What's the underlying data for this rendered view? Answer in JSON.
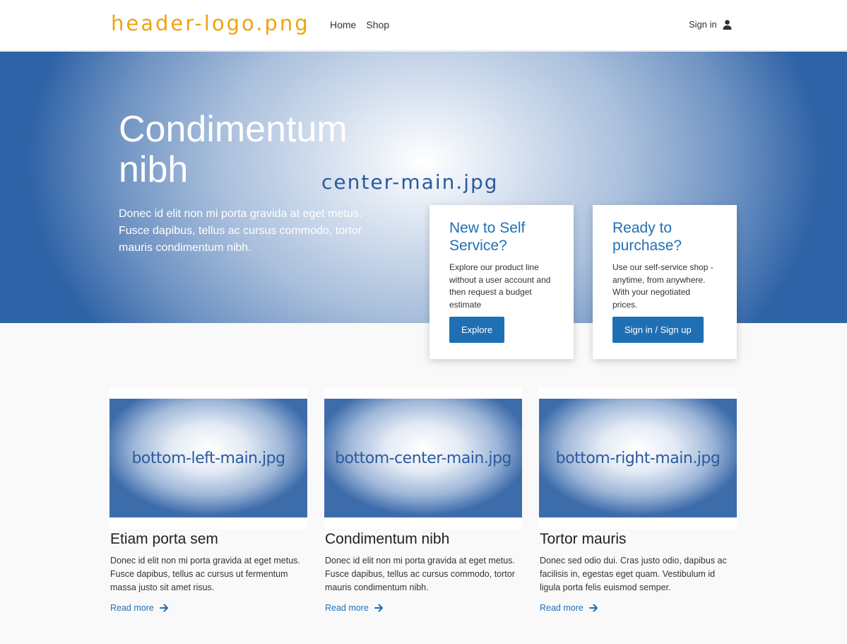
{
  "header": {
    "logo": "header-logo.png",
    "nav": [
      "Home",
      "Shop"
    ],
    "signin_label": "Sign in",
    "user_icon": "user-icon"
  },
  "hero": {
    "title": "Condimentum nibh",
    "subtitle": "Donec id elit non mi porta gravida at eget metus. Fusce dapibus, tellus ac cursus commodo, tortor mauris condimentum nibh.",
    "image_label": "center-main.jpg"
  },
  "cards": [
    {
      "title": "New to Self Service?",
      "text": "Explore our product line without a user account and then request a budget estimate",
      "button": "Explore"
    },
    {
      "title": "Ready to purchase?",
      "text": "Use our self-service shop - anytime, from anywhere. With your negotiated prices.",
      "button": "Sign in / Sign up"
    }
  ],
  "columns": [
    {
      "image_label": "bottom-left-main.jpg",
      "title": "Etiam porta sem",
      "text": "Donec id elit non mi porta gravida at eget metus. Fusce dapibus, tellus ac cursus ut fermentum massa justo sit amet risus.",
      "link": "Read more"
    },
    {
      "image_label": "bottom-center-main.jpg",
      "title": "Condimentum nibh",
      "text": "Donec id elit non mi porta gravida at eget metus. Fusce dapibus, tellus ac cursus commodo, tortor mauris condimentum nibh.",
      "link": "Read more"
    },
    {
      "image_label": "bottom-right-main.jpg",
      "title": "Tortor mauris",
      "text": "Donec sed odio dui. Cras justo odio, dapibus ac facilisis in, egestas eget quam. Vestibulum id ligula porta felis euismod semper.",
      "link": "Read more"
    }
  ],
  "colors": {
    "accent": "#1f6fb5",
    "logo": "#f0a30a",
    "hero_dark": "#2f63a7"
  }
}
